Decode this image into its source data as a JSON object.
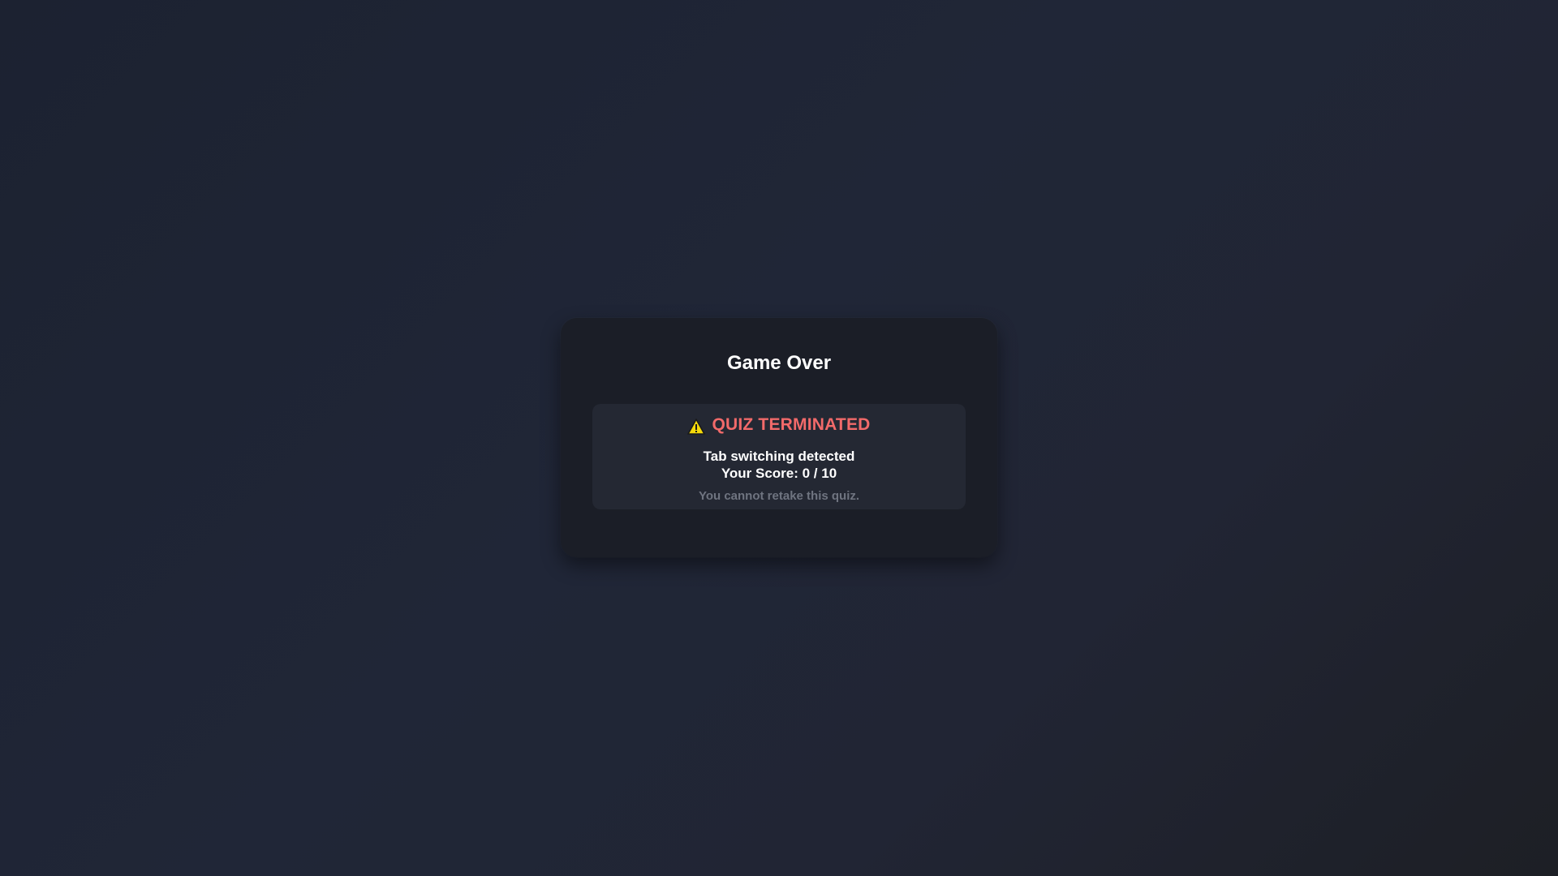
{
  "dialog": {
    "title": "Game Over",
    "status_icon": "warning-triangle-icon",
    "status_text": "QUIZ TERMINATED",
    "reason": "Tab switching detected",
    "score_text": "Your Score: 0 / 10",
    "note": "You cannot retake this quiz."
  },
  "colors": {
    "background": "#1f2433",
    "card": "#1b1e27",
    "panel": "#242833",
    "alert_red": "#f26a6a",
    "warning_yellow": "#f5d90a",
    "muted_text": "#6f7480"
  }
}
